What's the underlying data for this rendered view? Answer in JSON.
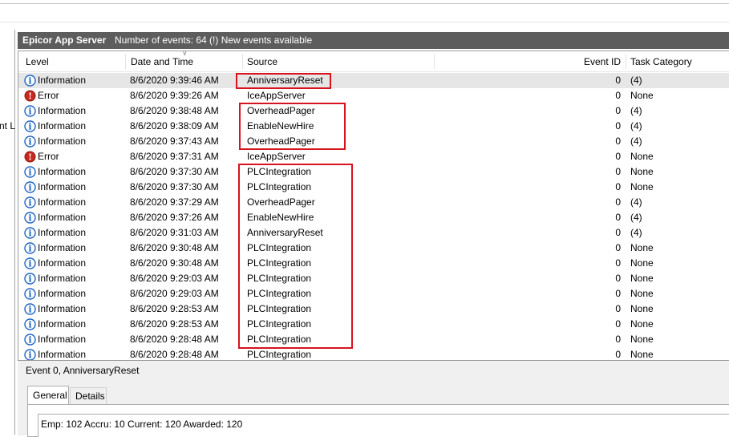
{
  "left_pane": {
    "fragment": "nt L"
  },
  "title_bar": {
    "app": "Epicor App Server",
    "count": "Number of events: 64 (!) New events available"
  },
  "columns": {
    "level": "Level",
    "date": "Date and Time",
    "source": "Source",
    "event_id": "Event ID",
    "task_category": "Task Category"
  },
  "events": [
    {
      "level": "Information",
      "icon": "info-icon",
      "date": "8/6/2020 9:39:46 AM",
      "source": "AnniversaryReset",
      "id": "0",
      "cat": "(4)"
    },
    {
      "level": "Error",
      "icon": "error-icon",
      "date": "8/6/2020 9:39:26 AM",
      "source": "IceAppServer",
      "id": "0",
      "cat": "None"
    },
    {
      "level": "Information",
      "icon": "info-icon",
      "date": "8/6/2020 9:38:48 AM",
      "source": "OverheadPager",
      "id": "0",
      "cat": "(4)"
    },
    {
      "level": "Information",
      "icon": "info-icon",
      "date": "8/6/2020 9:38:09 AM",
      "source": "EnableNewHire",
      "id": "0",
      "cat": "(4)"
    },
    {
      "level": "Information",
      "icon": "info-icon",
      "date": "8/6/2020 9:37:43 AM",
      "source": "OverheadPager",
      "id": "0",
      "cat": "(4)"
    },
    {
      "level": "Error",
      "icon": "error-icon",
      "date": "8/6/2020 9:37:31 AM",
      "source": "IceAppServer",
      "id": "0",
      "cat": "None"
    },
    {
      "level": "Information",
      "icon": "info-icon",
      "date": "8/6/2020 9:37:30 AM",
      "source": "PLCIntegration",
      "id": "0",
      "cat": "None"
    },
    {
      "level": "Information",
      "icon": "info-icon",
      "date": "8/6/2020 9:37:30 AM",
      "source": "PLCIntegration",
      "id": "0",
      "cat": "None"
    },
    {
      "level": "Information",
      "icon": "info-icon",
      "date": "8/6/2020 9:37:29 AM",
      "source": "OverheadPager",
      "id": "0",
      "cat": "(4)"
    },
    {
      "level": "Information",
      "icon": "info-icon",
      "date": "8/6/2020 9:37:26 AM",
      "source": "EnableNewHire",
      "id": "0",
      "cat": "(4)"
    },
    {
      "level": "Information",
      "icon": "info-icon",
      "date": "8/6/2020 9:31:03 AM",
      "source": "AnniversaryReset",
      "id": "0",
      "cat": "(4)"
    },
    {
      "level": "Information",
      "icon": "info-icon",
      "date": "8/6/2020 9:30:48 AM",
      "source": "PLCIntegration",
      "id": "0",
      "cat": "None"
    },
    {
      "level": "Information",
      "icon": "info-icon",
      "date": "8/6/2020 9:30:48 AM",
      "source": "PLCIntegration",
      "id": "0",
      "cat": "None"
    },
    {
      "level": "Information",
      "icon": "info-icon",
      "date": "8/6/2020 9:29:03 AM",
      "source": "PLCIntegration",
      "id": "0",
      "cat": "None"
    },
    {
      "level": "Information",
      "icon": "info-icon",
      "date": "8/6/2020 9:29:03 AM",
      "source": "PLCIntegration",
      "id": "0",
      "cat": "None"
    },
    {
      "level": "Information",
      "icon": "info-icon",
      "date": "8/6/2020 9:28:53 AM",
      "source": "PLCIntegration",
      "id": "0",
      "cat": "None"
    },
    {
      "level": "Information",
      "icon": "info-icon",
      "date": "8/6/2020 9:28:53 AM",
      "source": "PLCIntegration",
      "id": "0",
      "cat": "None"
    },
    {
      "level": "Information",
      "icon": "info-icon",
      "date": "8/6/2020 9:28:48 AM",
      "source": "PLCIntegration",
      "id": "0",
      "cat": "None"
    },
    {
      "level": "Information",
      "icon": "info-icon",
      "date": "8/6/2020 9:28:48 AM",
      "source": "PLCIntegration",
      "id": "0",
      "cat": "None"
    }
  ],
  "selected_index": 0,
  "detail": {
    "event_title": "Event 0, AnniversaryReset",
    "tabs": [
      "General",
      "Details"
    ],
    "description": "Emp: 102 Accru: 10 Current: 120 Awarded: 120"
  },
  "colors": {
    "title_bar": "#5d5d5d",
    "highlight": "#d7141e",
    "info_icon": "#1e64c8",
    "error_icon": "#c8281e"
  }
}
